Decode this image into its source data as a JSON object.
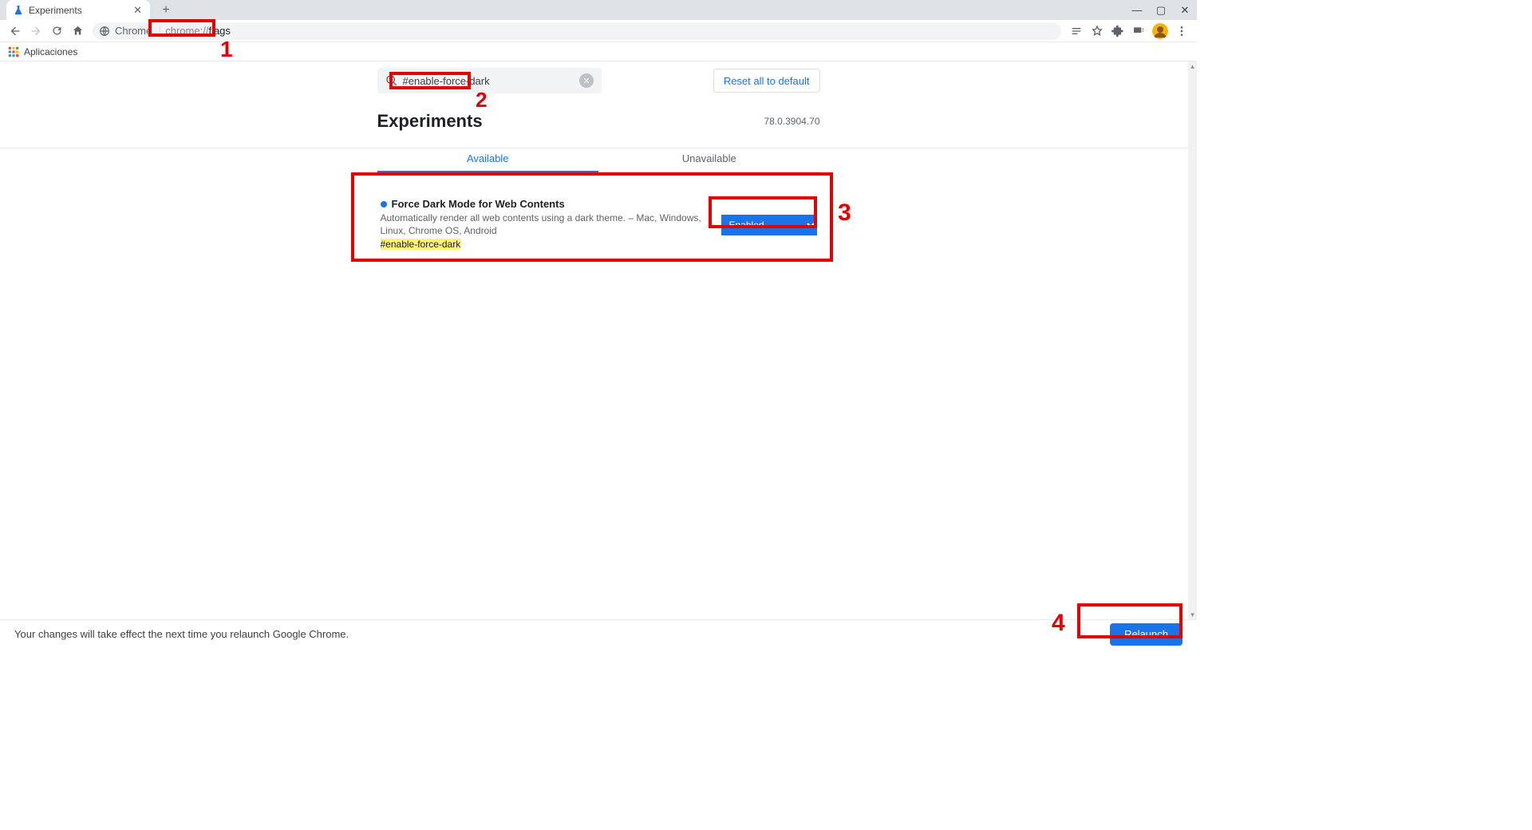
{
  "browser": {
    "tab_title": "Experiments",
    "omnibox_chip": "Chrome",
    "url_dim": "chrome://",
    "url_strong": "flags",
    "bookmarks_label": "Aplicaciones"
  },
  "page": {
    "search_query": "#enable-force-dark",
    "reset_button": "Reset all to default",
    "heading": "Experiments",
    "version": "78.0.3904.70",
    "tabs": {
      "available": "Available",
      "unavailable": "Unavailable"
    },
    "flag": {
      "title": "Force Dark Mode for Web Contents",
      "desc": "Automatically render all web contents using a dark theme. – Mac, Windows, Linux, Chrome OS, Android",
      "hash": "#enable-force-dark",
      "dropdown_value": "Enabled"
    }
  },
  "relaunch": {
    "message": "Your changes will take effect the next time you relaunch Google Chrome.",
    "button": "Relaunch"
  },
  "annotations": {
    "n1": "1",
    "n2": "2",
    "n3": "3",
    "n4": "4"
  }
}
